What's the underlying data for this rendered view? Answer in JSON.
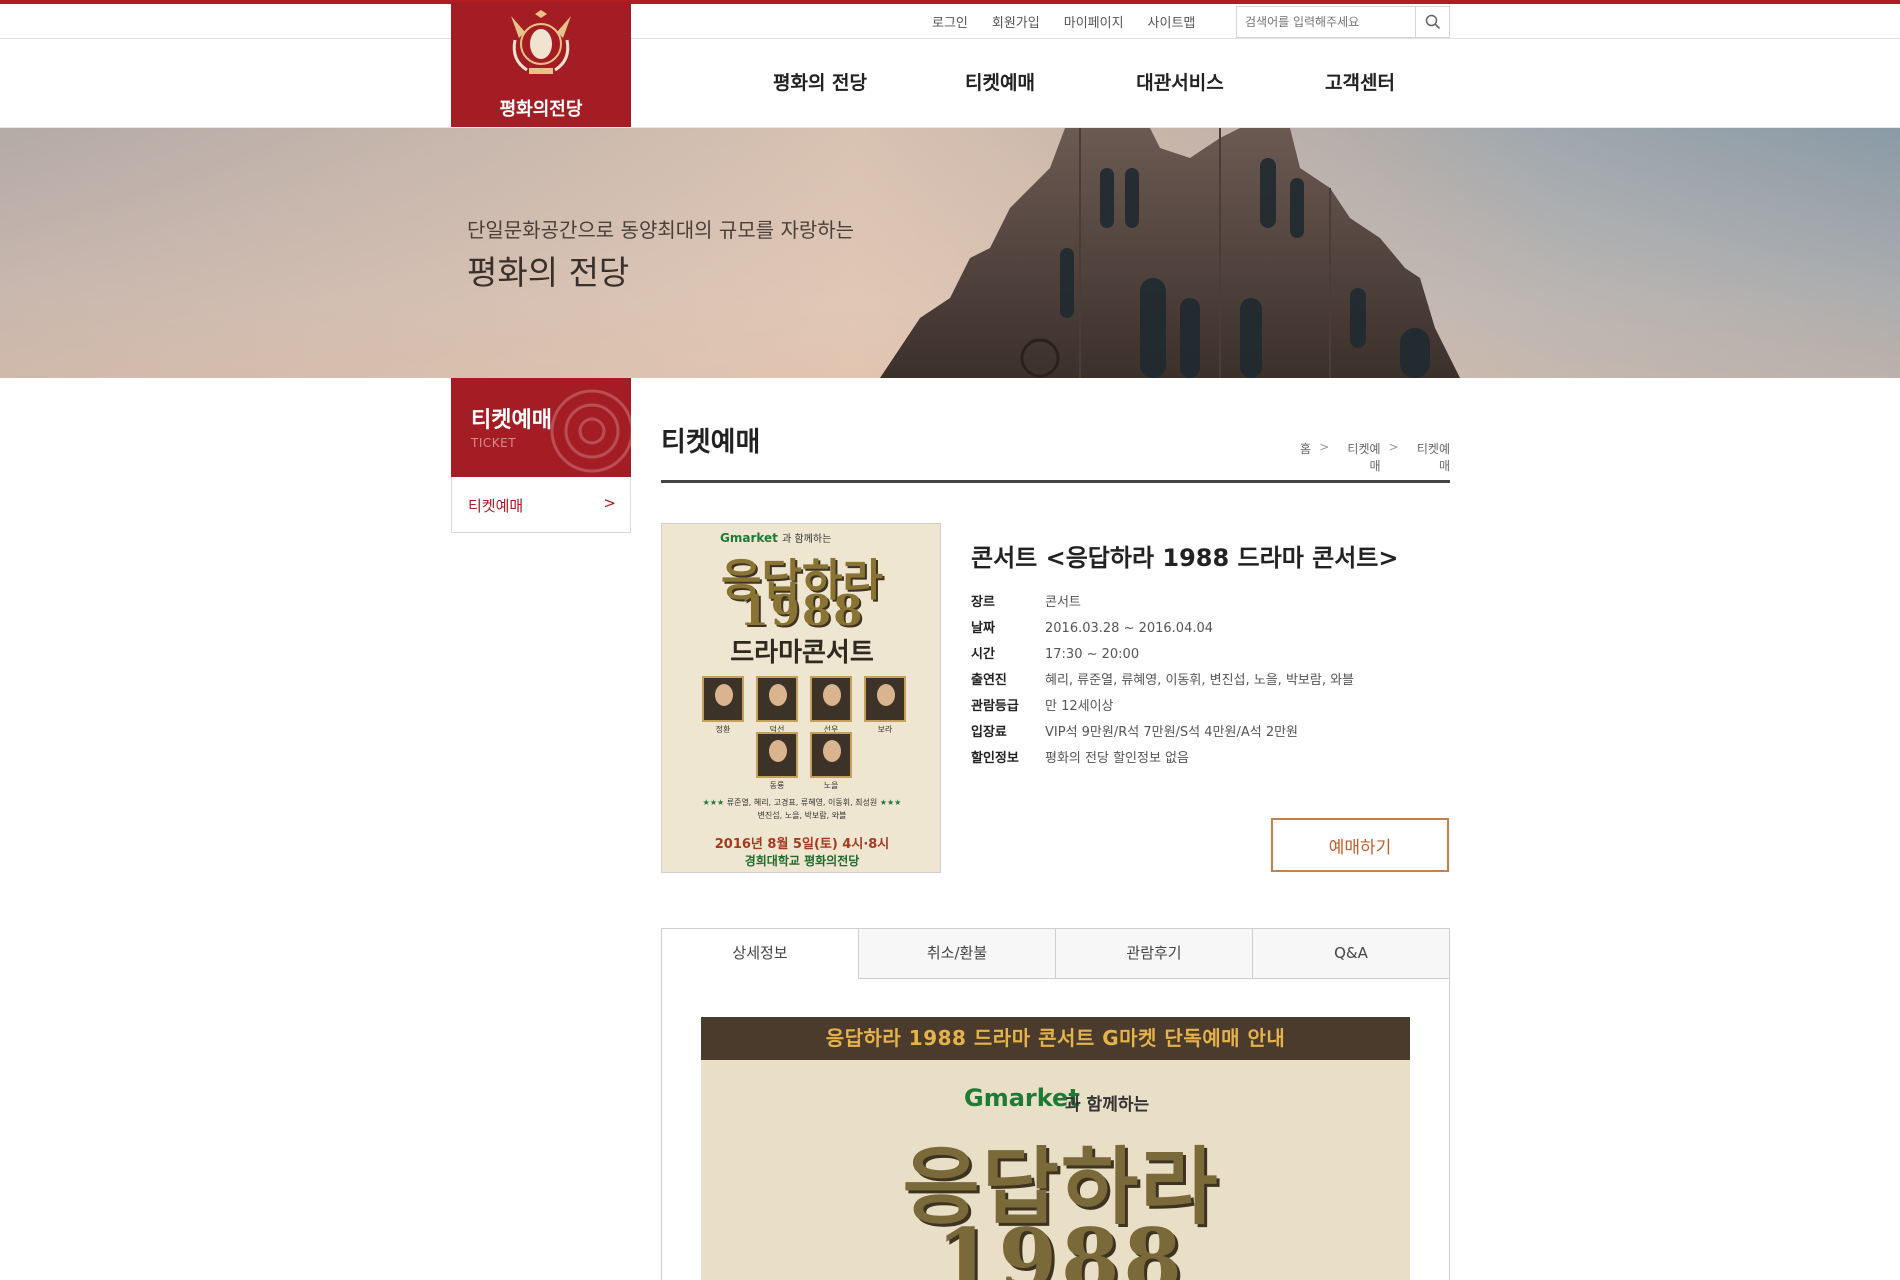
{
  "header": {
    "logo_text": "평화의전당",
    "util_links": [
      "로그인",
      "회원가입",
      "마이페이지",
      "사이트맵"
    ],
    "search_placeholder": "검색어를 입력해주세요",
    "gnb": [
      "평화의 전당",
      "티켓예매",
      "대관서비스",
      "고객센터"
    ]
  },
  "hero": {
    "sub": "단일문화공간으로 동양최대의 규모를 자랑하는",
    "main": "평화의 전당"
  },
  "sidebar": {
    "title": "티켓예매",
    "subtitle": "TICKET",
    "items": [
      {
        "label": "티켓예매",
        "arrow": ">"
      }
    ]
  },
  "content": {
    "page_title": "티켓예매",
    "breadcrumb": [
      "홈",
      "티켓예매",
      "티켓예매"
    ],
    "breadcrumb_sep": ">",
    "show": {
      "title": "콘서트 <응답하라 1988 드라마 콘서트>",
      "info": [
        {
          "label": "장르",
          "value": "콘서트"
        },
        {
          "label": "날짜",
          "value": "2016.03.28 ~ 2016.04.04"
        },
        {
          "label": "시간",
          "value": "17:30 ~ 20:00"
        },
        {
          "label": "출연진",
          "value": "혜리, 류준열, 류혜영, 이동휘, 변진섭, 노을, 박보람, 와블"
        },
        {
          "label": "관람등급",
          "value": "만 12세이상"
        },
        {
          "label": "입장료",
          "value": "VIP석 9만원/R석 7만원/S석 4만원/A석 2만원"
        },
        {
          "label": "할인정보",
          "value": "평화의 전당 할인정보 없음"
        }
      ],
      "book_button": "예매하기"
    },
    "poster": {
      "gmarket": "Gmarket",
      "gmarket_suffix": "과 함께하는",
      "title_line1": "응답하라",
      "title_line2": "1988",
      "title_line3": "드라마콘서트",
      "cast_names": [
        "정환",
        "덕선",
        "선우",
        "보라",
        "동룡",
        "노을"
      ],
      "cast_line1": "류준열, 혜리, 고경표, 류혜영, 이동휘, 최성원",
      "cast_line2": "변진섭, 노을, 박보람, 와블",
      "date": "2016년 8월 5일(토) 4시·8시",
      "venue": "경희대학교 평화의전당"
    },
    "tabs": [
      "상세정보",
      "취소/환불",
      "관람후기",
      "Q&A"
    ],
    "active_tab": "상세정보",
    "detail": {
      "banner": "응답하라 1988 드라마 콘서트 G마켓 단독예매 안내",
      "gmarket": "Gmarket",
      "gmarket_suffix": "과 함께하는",
      "title_line1": "응답하라",
      "title_line2": "1988"
    }
  },
  "colors": {
    "brand": "#a51d24",
    "book_button": "#c78048",
    "detail_banner_bg": "#4a3b2c"
  }
}
